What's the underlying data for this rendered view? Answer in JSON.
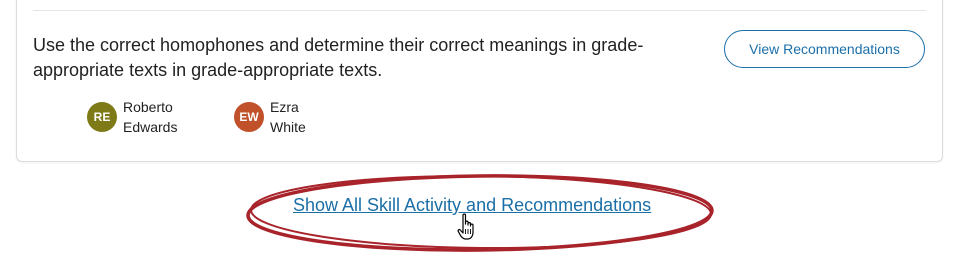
{
  "skill_card": {
    "description": "Use the correct homophones and determine their correct meanings in grade-appropriate texts in grade-appropriate texts.",
    "recommendations_button_label": "View Recommendations",
    "students": [
      {
        "initials": "RE",
        "first_name": "Roberto",
        "last_name": "Edwards",
        "avatar_color": "#7d7a17"
      },
      {
        "initials": "EW",
        "first_name": "Ezra",
        "last_name": "White",
        "avatar_color": "#c0512a"
      }
    ]
  },
  "show_all_link_label": "Show All Skill Activity and Recommendations",
  "colors": {
    "link": "#1b6fa8",
    "highlight_ellipse": "#a8232a",
    "card_border": "#d9dde1"
  },
  "icons": {
    "cursor": "hand-pointer-icon"
  }
}
